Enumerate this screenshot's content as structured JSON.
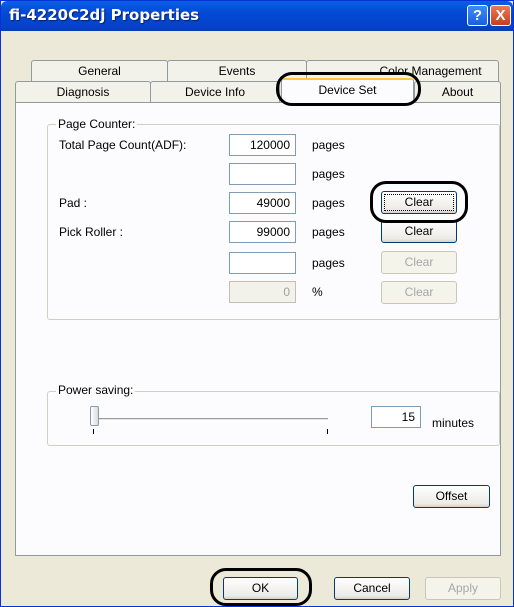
{
  "window": {
    "title": "fi-4220C2dj Properties"
  },
  "titlebar": {
    "help_glyph": "?",
    "close_glyph": "X"
  },
  "tabs": {
    "row1": [
      "General",
      "Events",
      "Color Management"
    ],
    "row2": [
      "Diagnosis",
      "Device Info",
      "Device Set",
      "About"
    ],
    "active": "Device Set"
  },
  "page_counter": {
    "title": "Page Counter:",
    "rows": [
      {
        "label": "Total Page Count(ADF):",
        "value": "120000",
        "unit": "pages",
        "has_clear": false
      },
      {
        "label": "",
        "value": "",
        "unit": "pages",
        "has_clear": false
      },
      {
        "label": "Pad :",
        "value": "49000",
        "unit": "pages",
        "clear_label": "Clear",
        "clear_enabled": true,
        "clear_focused": true
      },
      {
        "label": "Pick Roller :",
        "value": "99000",
        "unit": "pages",
        "clear_label": "Clear",
        "clear_enabled": true
      },
      {
        "label": "",
        "value": "",
        "unit": "pages",
        "clear_label": "Clear",
        "clear_enabled": false
      },
      {
        "label": "",
        "value": "0",
        "unit": "%",
        "clear_label": "Clear",
        "clear_enabled": false
      }
    ]
  },
  "power_saving": {
    "title": "Power saving:",
    "value": "15",
    "unit": "minutes",
    "slider_level": 0.0
  },
  "buttons": {
    "offset": "Offset",
    "ok": "OK",
    "cancel": "Cancel",
    "apply": "Apply"
  }
}
